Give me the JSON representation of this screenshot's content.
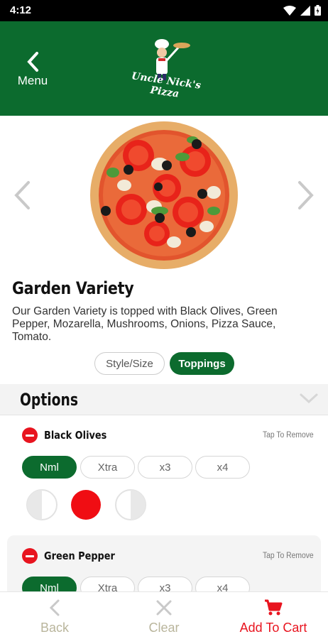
{
  "status_bar": {
    "time": "4:12"
  },
  "header": {
    "back_label": "Menu",
    "logo_text": "Uncle Nick's Pizza"
  },
  "product": {
    "title": "Garden Variety",
    "description": "Our Garden Variety is topped with Black Olives, Green Pepper, Mozarella, Mushrooms, Onions, Pizza Sauce, Tomato."
  },
  "segments": {
    "style_size": "Style/Size",
    "toppings": "Toppings",
    "selected": "Toppings"
  },
  "options": {
    "title": "Options",
    "toppings": [
      {
        "name": "Black Olives",
        "action": "Tap To Remove",
        "quantities": [
          "Nml",
          "Xtra",
          "x3",
          "x4"
        ],
        "selected_quantity": "Nml",
        "selected_portion": "whole"
      },
      {
        "name": "Green Pepper",
        "action": "Tap To Remove",
        "quantities": [
          "Nml",
          "Xtra",
          "x3",
          "x4"
        ],
        "selected_quantity": "Nml"
      }
    ]
  },
  "bottom_bar": {
    "back": "Back",
    "clear": "Clear",
    "add_to_cart": "Add To Cart"
  },
  "colors": {
    "brand_green": "#0c6b2e",
    "accent_red": "#e8141f",
    "disabled_text": "#b9b59c"
  },
  "icons": {
    "back_menu": "chevron-left-icon",
    "prev": "chevron-left-icon",
    "next": "chevron-right-icon",
    "options_toggle": "chevron-down-icon",
    "remove": "minus-circle-icon",
    "back": "chevron-left-icon",
    "clear": "close-icon",
    "cart": "cart-icon"
  }
}
